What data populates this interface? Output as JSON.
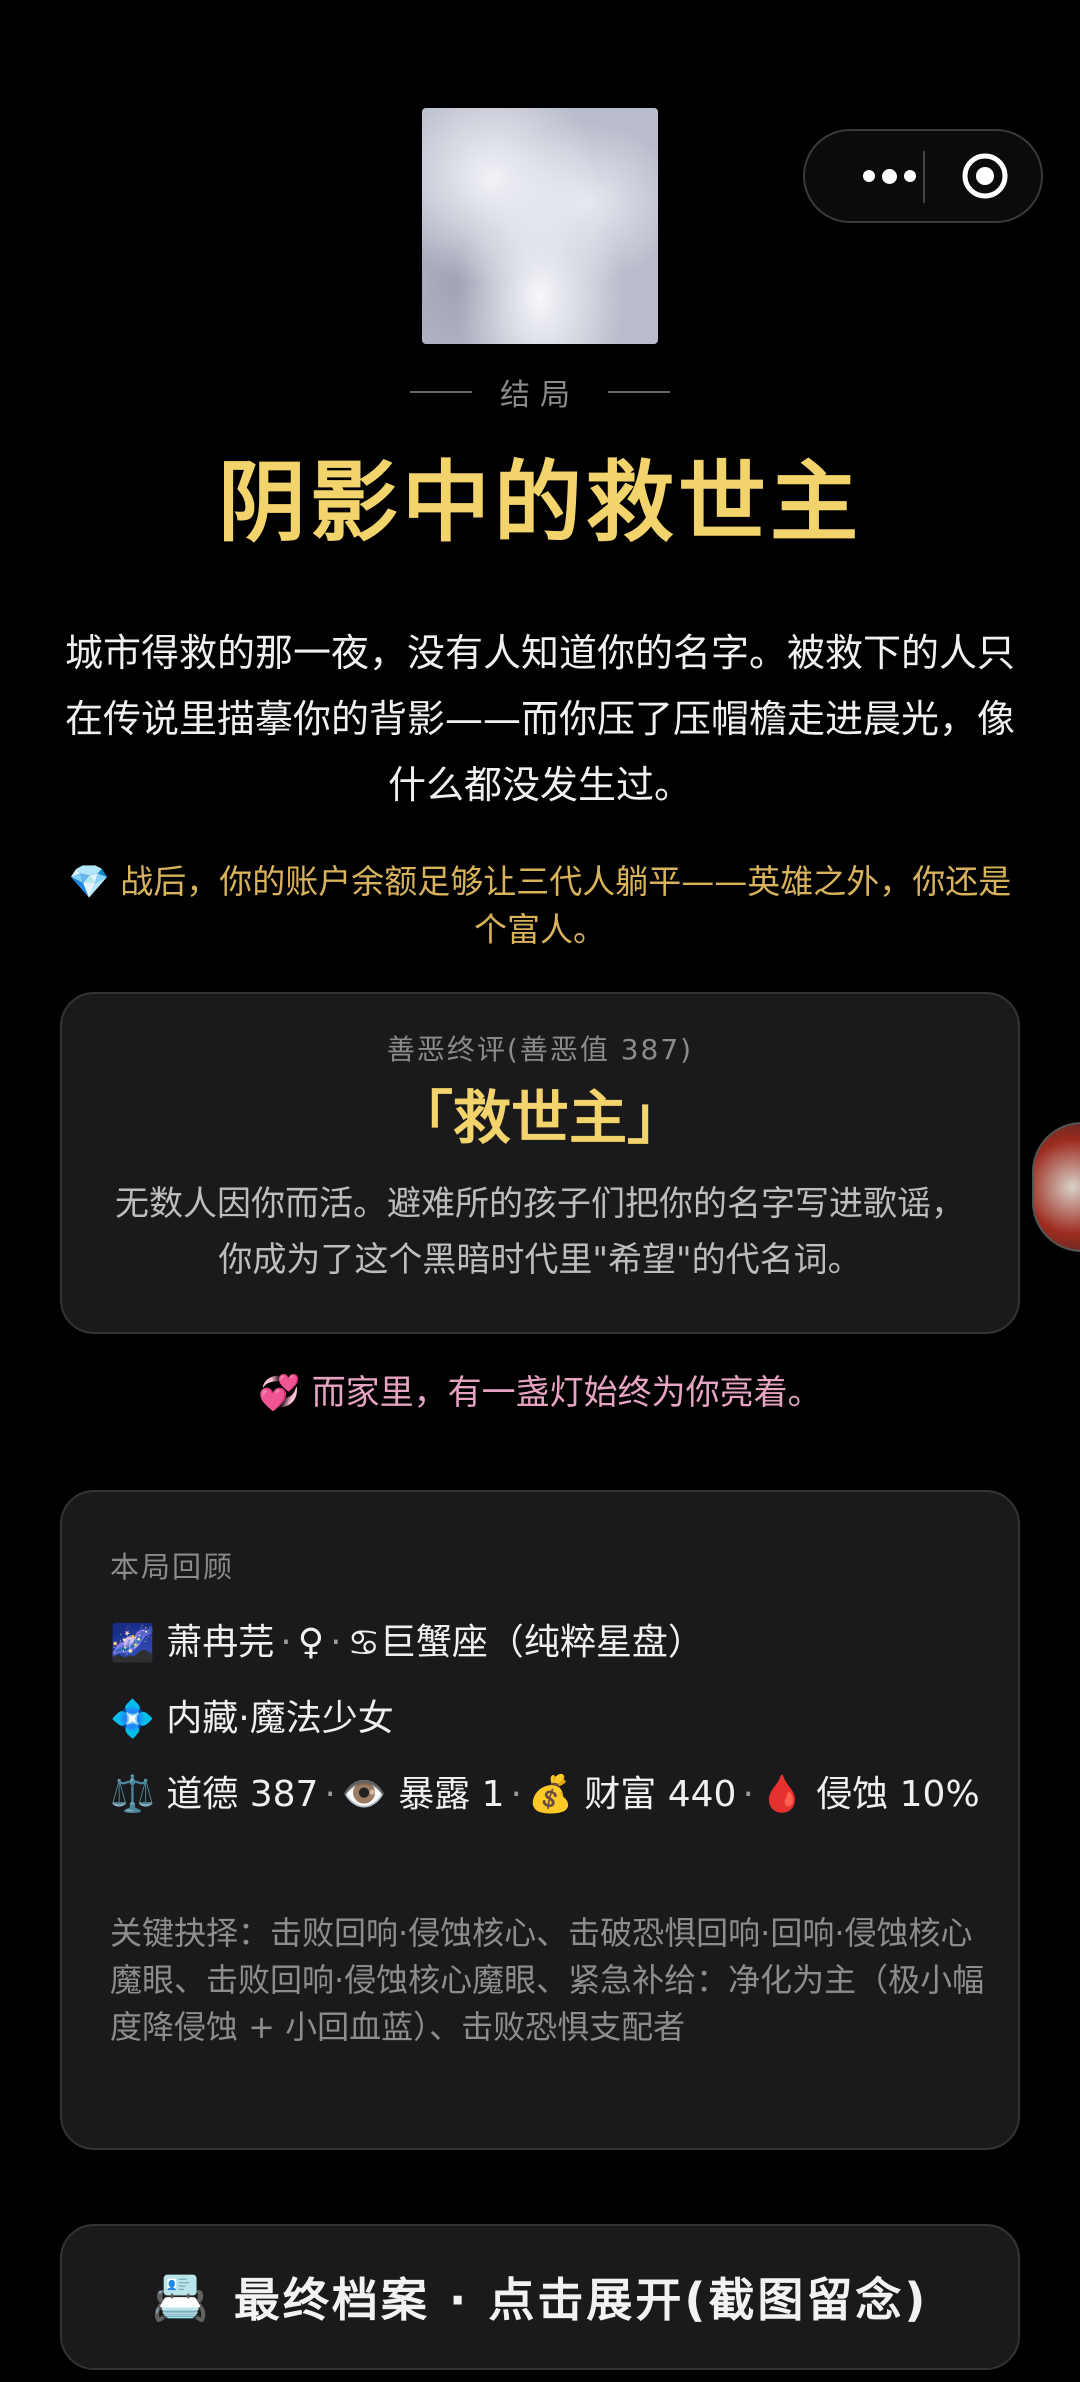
{
  "capsule": {
    "menu_icon": "more-dots-icon",
    "close_icon": "target-circle-icon"
  },
  "cover": {
    "icon": "cloud-image"
  },
  "ending": {
    "label": "结局",
    "title": "阴影中的救世主",
    "story": "城市得救的那一夜，没有人知道你的名字。被救下的人只在传说里描摹你的背影——而你压了压帽檐走进晨光，像什么都没发生过。",
    "wealth_icon": "💎",
    "wealth_text": "战后，你的账户余额足够让三代人躺平——英雄之外，你还是个富人。"
  },
  "verdict": {
    "subtitle": "善恶终评(善恶值 387)",
    "name": "「救世主」",
    "description": "无数人因你而活。避难所的孩子们把你的名字写进歌谣，你成为了这个黑暗时代里\"希望\"的代名词。"
  },
  "home": {
    "icon": "💞",
    "text": "而家里，有一盏灯始终为你亮着。"
  },
  "review": {
    "heading": "本局回顾",
    "star_icon": "🌌",
    "player_name": "萧冉芫",
    "gender": "♀",
    "sign_icon": "♋",
    "sign_text": "巨蟹座（纯粹星盘）",
    "hidden_icon": "💠",
    "hidden_text": "内藏·魔法少女",
    "stats": [
      {
        "icon": "⚖️",
        "label": "道德 387"
      },
      {
        "icon": "👁️",
        "label": "暴露 1"
      },
      {
        "icon": "💰",
        "label": "财富 440"
      },
      {
        "icon": "🩸",
        "label": "侵蚀 10%"
      }
    ],
    "key_choices": "关键抉择：击败回响·侵蚀核心、击破恐惧回响·回响·侵蚀核心魔眼、击败回响·侵蚀核心魔眼、紧急补给：净化为主（极小幅度降侵蚀 + 小回血蓝）、击败恐惧支配者"
  },
  "archive": {
    "icon": "📇",
    "label": "最终档案 · 点击展开(截图留念)"
  },
  "colors": {
    "gold": "#f3d36b",
    "wealth": "#d9b25c",
    "pink": "#e6a3c3",
    "card": "#1a1a1c"
  }
}
